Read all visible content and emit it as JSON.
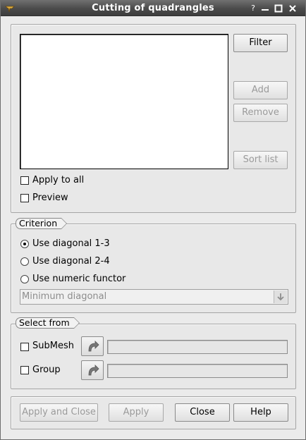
{
  "window": {
    "title": "Cutting of quadrangles",
    "controls": {
      "help": "?",
      "minimize": "minimize-icon",
      "maximize": "maximize-icon",
      "close": "close-icon"
    }
  },
  "elements_panel": {
    "filter_label": "Filter",
    "add_label": "Add",
    "remove_label": "Remove",
    "sort_label": "Sort list",
    "apply_to_all_label": "Apply to all",
    "preview_label": "Preview",
    "apply_to_all_checked": false,
    "preview_checked": false
  },
  "criterion": {
    "title": "Criterion",
    "options": [
      "Use diagonal 1-3",
      "Use diagonal 2-4",
      "Use numeric functor"
    ],
    "selected_index": 0,
    "functor_value": "Minimum diagonal"
  },
  "select_from": {
    "title": "Select from",
    "submesh_label": "SubMesh",
    "group_label": "Group",
    "submesh_value": "",
    "group_value": ""
  },
  "footer": {
    "apply_close_label": "Apply and Close",
    "apply_label": "Apply",
    "close_label": "Close",
    "help_label": "Help"
  },
  "colors": {
    "titlebar": "#4a4a4a",
    "panel": "#e8e8e8",
    "disabled_text": "#9a9a9a"
  }
}
